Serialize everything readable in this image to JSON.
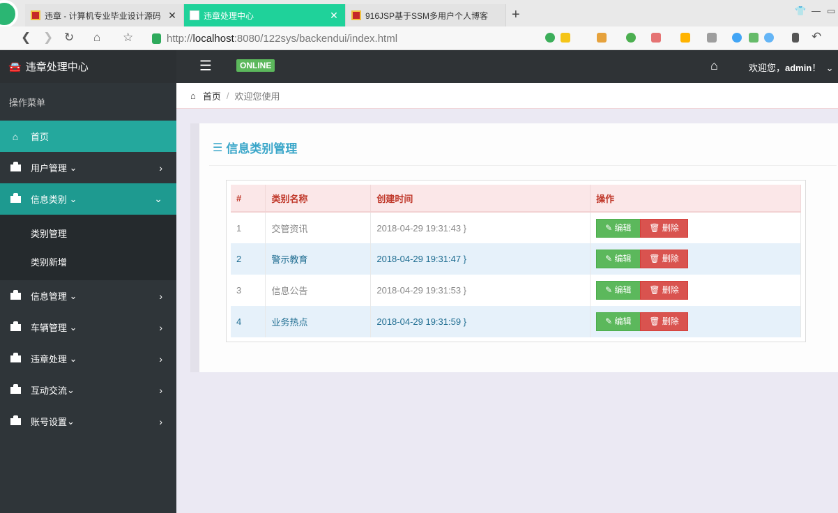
{
  "browser": {
    "tabs": [
      {
        "title": "违章 - 计算机专业毕业设计源码"
      },
      {
        "title": "违章处理中心"
      },
      {
        "title": "916JSP基于SSM多用户个人博客"
      }
    ],
    "url_scheme": "http://",
    "url_host": "localhost",
    "url_path": ":8080/122sys/backendui/index.html"
  },
  "header": {
    "brand": "违章处理中心",
    "online_badge": "ONLINE",
    "welcome_prefix": "欢迎您，",
    "username": "admin",
    "welcome_suffix": "！"
  },
  "sidebar": {
    "title": "操作菜单",
    "items": [
      {
        "label": "首页"
      },
      {
        "label": "用户管理"
      },
      {
        "label": "信息类别"
      },
      {
        "label": "信息管理"
      },
      {
        "label": "车辆管理"
      },
      {
        "label": "违章处理"
      },
      {
        "label": "互动交流"
      },
      {
        "label": "账号设置"
      }
    ],
    "subitems": [
      {
        "label": "类别管理"
      },
      {
        "label": "类别新增"
      }
    ]
  },
  "breadcrumb": {
    "home": "首页",
    "sep": "/",
    "current": "欢迎您使用"
  },
  "panel": {
    "title": "信息类别管理"
  },
  "table": {
    "headers": [
      "#",
      "类别名称",
      "创建时间",
      "操作"
    ],
    "rows": [
      {
        "id": "1",
        "name": "交管资讯",
        "created": "2018-04-29 19:31:43 }"
      },
      {
        "id": "2",
        "name": "警示教育",
        "created": "2018-04-29 19:31:47 }"
      },
      {
        "id": "3",
        "name": "信息公告",
        "created": "2018-04-29 19:31:53 }"
      },
      {
        "id": "4",
        "name": "业务热点",
        "created": "2018-04-29 19:31:59 }"
      }
    ],
    "edit_label": "编辑",
    "delete_label": "删除"
  },
  "colors": {
    "header_bg": "#2f3336",
    "sidebar_bg": "#2f3539",
    "sidebar_active": "#24a89d",
    "title_blue": "#3aa6c9",
    "edit_green": "#5cb85c",
    "delete_red": "#d9534f",
    "active_tab": "#1fd29a"
  }
}
